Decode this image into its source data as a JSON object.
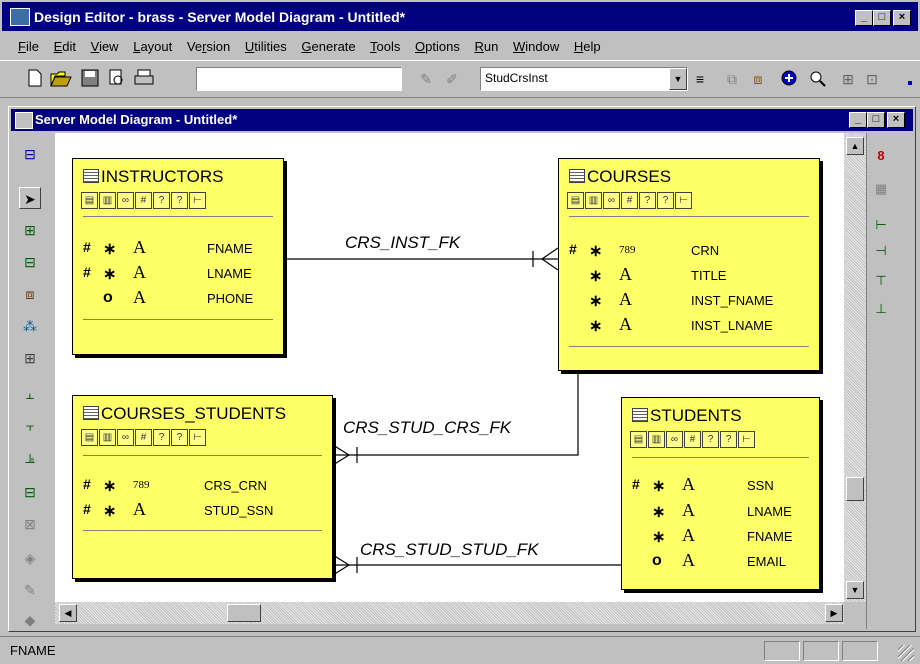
{
  "app": {
    "title": "Design Editor - brass - Server Model Diagram - Untitled*",
    "btn_min": "_",
    "btn_max": "□",
    "btn_close": "×"
  },
  "menu": [
    "File",
    "Edit",
    "View",
    "Layout",
    "Version",
    "Utilities",
    "Generate",
    "Tools",
    "Options",
    "Run",
    "Window",
    "Help"
  ],
  "menu_underline": [
    "F",
    "E",
    "V",
    "L",
    "r",
    "U",
    "G",
    "T",
    "O",
    "R",
    "W",
    "H"
  ],
  "toolbar": {
    "text_field_value": "",
    "object_select_value": "StudCrsInst",
    "icons": [
      "new-file-icon",
      "open-folder-icon",
      "save-icon",
      "print-preview-icon",
      "print-icon"
    ]
  },
  "doc_window": {
    "title": "Server Model Diagram - Untitled*"
  },
  "entities": {
    "instructors": {
      "name": "INSTRUCTORS",
      "columns": [
        {
          "key": "#",
          "mand": "∗",
          "type": "A",
          "name": "FNAME"
        },
        {
          "key": "#",
          "mand": "∗",
          "type": "A",
          "name": "LNAME"
        },
        {
          "key": "",
          "mand": "o",
          "type": "A",
          "name": "PHONE"
        }
      ]
    },
    "courses": {
      "name": "COURSES",
      "columns": [
        {
          "key": "#",
          "mand": "∗",
          "type": "789",
          "name": "CRN"
        },
        {
          "key": "",
          "mand": "∗",
          "type": "A",
          "name": "TITLE"
        },
        {
          "key": "",
          "mand": "∗",
          "type": "A",
          "name": "INST_FNAME"
        },
        {
          "key": "",
          "mand": "∗",
          "type": "A",
          "name": "INST_LNAME"
        }
      ]
    },
    "courses_students": {
      "name": "COURSES_STUDENTS",
      "columns": [
        {
          "key": "#",
          "mand": "∗",
          "type": "789",
          "name": "CRS_CRN"
        },
        {
          "key": "#",
          "mand": "∗",
          "type": "A",
          "name": "STUD_SSN"
        }
      ]
    },
    "students": {
      "name": "STUDENTS",
      "columns": [
        {
          "key": "#",
          "mand": "∗",
          "type": "A",
          "name": "SSN"
        },
        {
          "key": "",
          "mand": "∗",
          "type": "A",
          "name": "LNAME"
        },
        {
          "key": "",
          "mand": "∗",
          "type": "A",
          "name": "FNAME"
        },
        {
          "key": "",
          "mand": "o",
          "type": "A",
          "name": "EMAIL"
        }
      ]
    }
  },
  "relations": {
    "crs_inst": "CRS_INST_FK",
    "crs_stud_crs": "CRS_STUD_CRS_FK",
    "crs_stud_stud": "CRS_STUD_STUD_FK"
  },
  "status": {
    "text": "FNAME"
  },
  "colors": {
    "entity_fill": "#ffff66",
    "titlebar": "#000080",
    "chrome": "#c0c0c0"
  }
}
